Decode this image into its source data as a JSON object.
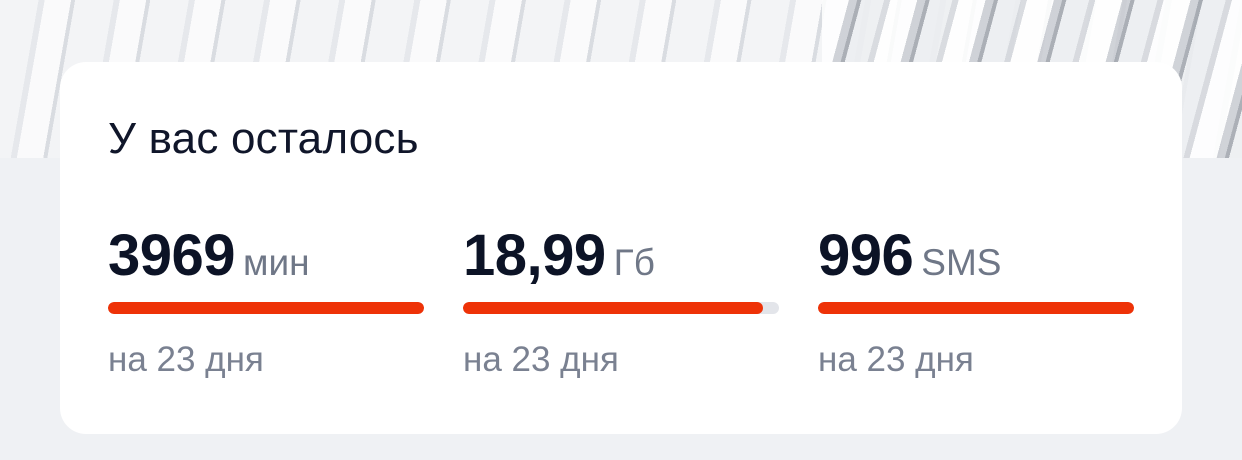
{
  "card": {
    "title": "У вас осталось"
  },
  "balances": [
    {
      "amount": "3969",
      "unit": "мин",
      "progress_percent": 100,
      "period": "на 23 дня"
    },
    {
      "amount": "18,99",
      "unit": "Гб",
      "progress_percent": 95,
      "period": "на 23 дня"
    },
    {
      "amount": "996",
      "unit": "SMS",
      "progress_percent": 100,
      "period": "на 23 дня"
    }
  ],
  "colors": {
    "accent": "#ee3207",
    "track": "#e3e5ea",
    "title": "#10162a",
    "unit": "#6f7787"
  }
}
